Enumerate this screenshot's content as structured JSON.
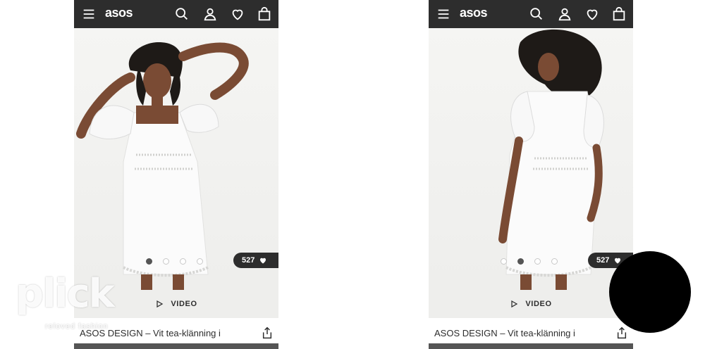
{
  "screens": [
    {
      "header": {
        "logo": "asos"
      },
      "saves_count": "527",
      "video_label": "VIDEO",
      "product_name": "ASOS DESIGN – Vit tea-klänning i",
      "carousel": {
        "total": 4,
        "active": 1
      }
    },
    {
      "header": {
        "logo": "asos"
      },
      "saves_count": "527",
      "video_label": "VIDEO",
      "product_name": "ASOS DESIGN – Vit tea-klänning i",
      "carousel": {
        "total": 4,
        "active": 2
      }
    }
  ],
  "watermark": {
    "brand": "plick",
    "tagline": "reloved fashion"
  },
  "colors": {
    "header_bg": "#2d2d2d",
    "page_bg": "#f3f3f1",
    "accent_dark": "#2d2d2d"
  },
  "icons": [
    "menu-icon",
    "search-icon",
    "account-icon",
    "heart-icon",
    "bag-icon",
    "play-icon",
    "share-icon"
  ]
}
